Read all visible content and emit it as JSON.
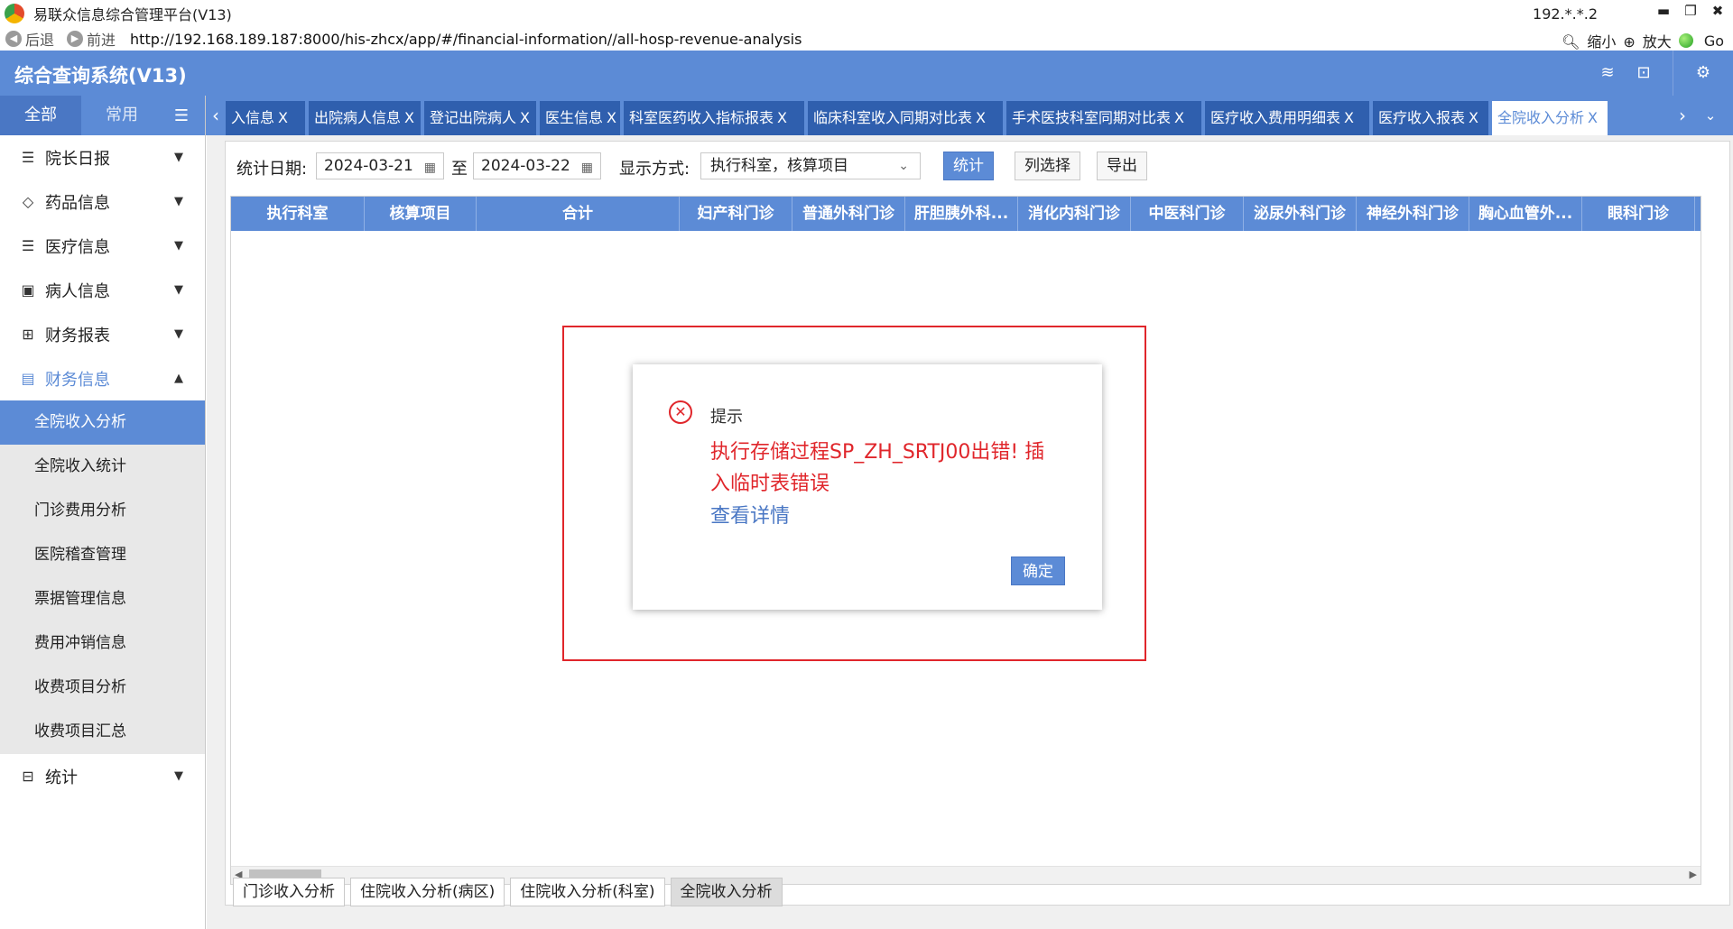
{
  "window": {
    "title": "易联众信息综合管理平台(V13)",
    "ip": "192.*.*.2",
    "minimize_glyph": "▬",
    "restore_glyph": "❐",
    "close_glyph": "✖"
  },
  "addressbar": {
    "back_label": "后退",
    "forward_label": "前进",
    "url": "http://192.168.189.187:8000/his-zhcx/app/#/financial-information//all-hosp-revenue-analysis",
    "zoom_out_label": "缩小",
    "zoom_in_label": "放大",
    "go_label": "Go"
  },
  "header": {
    "app_title": "综合查询系统(V13)"
  },
  "sidebar": {
    "tabs": [
      {
        "label": "全部"
      },
      {
        "label": "常用"
      }
    ],
    "items": [
      {
        "label": "院长日报",
        "icon": "list-icon"
      },
      {
        "label": "药品信息",
        "icon": "pill-icon"
      },
      {
        "label": "医疗信息",
        "icon": "list-icon"
      },
      {
        "label": "病人信息",
        "icon": "calendar-icon"
      },
      {
        "label": "财务报表",
        "icon": "finance-icon"
      },
      {
        "label": "财务信息",
        "icon": "document-icon"
      }
    ],
    "sub_items": [
      {
        "label": "全院收入分析"
      },
      {
        "label": "全院收入统计"
      },
      {
        "label": "门诊费用分析"
      },
      {
        "label": "医院稽查管理"
      },
      {
        "label": "票据管理信息"
      },
      {
        "label": "费用冲销信息"
      },
      {
        "label": "收费项目分析"
      },
      {
        "label": "收费项目汇总"
      }
    ],
    "stats_label": "统计"
  },
  "tabs": [
    {
      "label": "入信息"
    },
    {
      "label": "出院病人信息"
    },
    {
      "label": "登记出院病人"
    },
    {
      "label": "医生信息"
    },
    {
      "label": "科室医药收入指标报表"
    },
    {
      "label": "临床科室收入同期对比表"
    },
    {
      "label": "手术医技科室同期对比表"
    },
    {
      "label": "医疗收入费用明细表"
    },
    {
      "label": "医疗收入报表"
    },
    {
      "label": "全院收入分析"
    }
  ],
  "toolbar": {
    "date_label": "统计日期:",
    "date_from": "2024-03-21",
    "to_label": "至",
    "date_to": "2024-03-22",
    "display_label": "显示方式:",
    "display_value": "执行科室，核算项目",
    "stat_button": "统计",
    "column_button": "列选择",
    "export_button": "导出"
  },
  "grid": {
    "columns": [
      "执行科室",
      "核算项目",
      "合计",
      "妇产科门诊",
      "普通外科门诊",
      "肝胆胰外科...",
      "消化内科门诊",
      "中医科门诊",
      "泌尿外科门诊",
      "神经外科门诊",
      "胸心血管外...",
      "眼科门诊"
    ]
  },
  "bottom_tabs": [
    {
      "label": "门诊收入分析"
    },
    {
      "label": "住院收入分析(病区)"
    },
    {
      "label": "住院收入分析(科室)"
    },
    {
      "label": "全院收入分析"
    }
  ],
  "dialog": {
    "title": "提示",
    "message": "执行存储过程SP_ZH_SRTJ00出错! 插入临时表错误",
    "detail_link": "查看详情",
    "ok_button": "确定"
  },
  "colors": {
    "accent": "#5c8bd6",
    "error": "#e0262b"
  }
}
